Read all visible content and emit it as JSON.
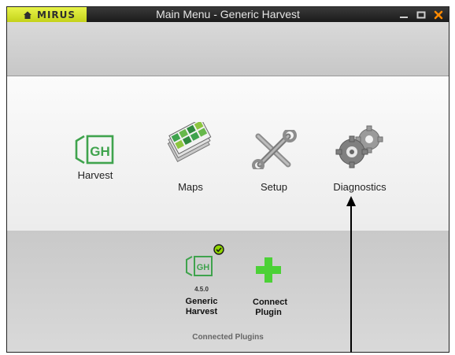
{
  "window": {
    "brand": "MIRUS",
    "title": "Main Menu - Generic Harvest",
    "controls": [
      "minimize-icon",
      "maximize-icon",
      "close-icon"
    ]
  },
  "menu": {
    "items": [
      {
        "label": "Harvest",
        "icon": "gh-harvest-icon"
      },
      {
        "label": "Maps",
        "icon": "maps-icon"
      },
      {
        "label": "Setup",
        "icon": "wrench-screwdriver-icon"
      },
      {
        "label": "Diagnostics",
        "icon": "gears-icon"
      }
    ]
  },
  "plugins": {
    "items": [
      {
        "name": "Generic Harvest",
        "version": "4.5.0",
        "status": "connected",
        "icon": "gh-plugin-icon"
      },
      {
        "name": "Connect Plugin",
        "icon": "plus-icon"
      }
    ],
    "section_label": "Connected Plugins"
  },
  "colors": {
    "brand_yellow": "#d4e12a",
    "gh_green": "#3fa34d",
    "plus_green": "#4cd137",
    "close_orange": "#ff8a00",
    "titlebar": "#2a2a2a"
  }
}
